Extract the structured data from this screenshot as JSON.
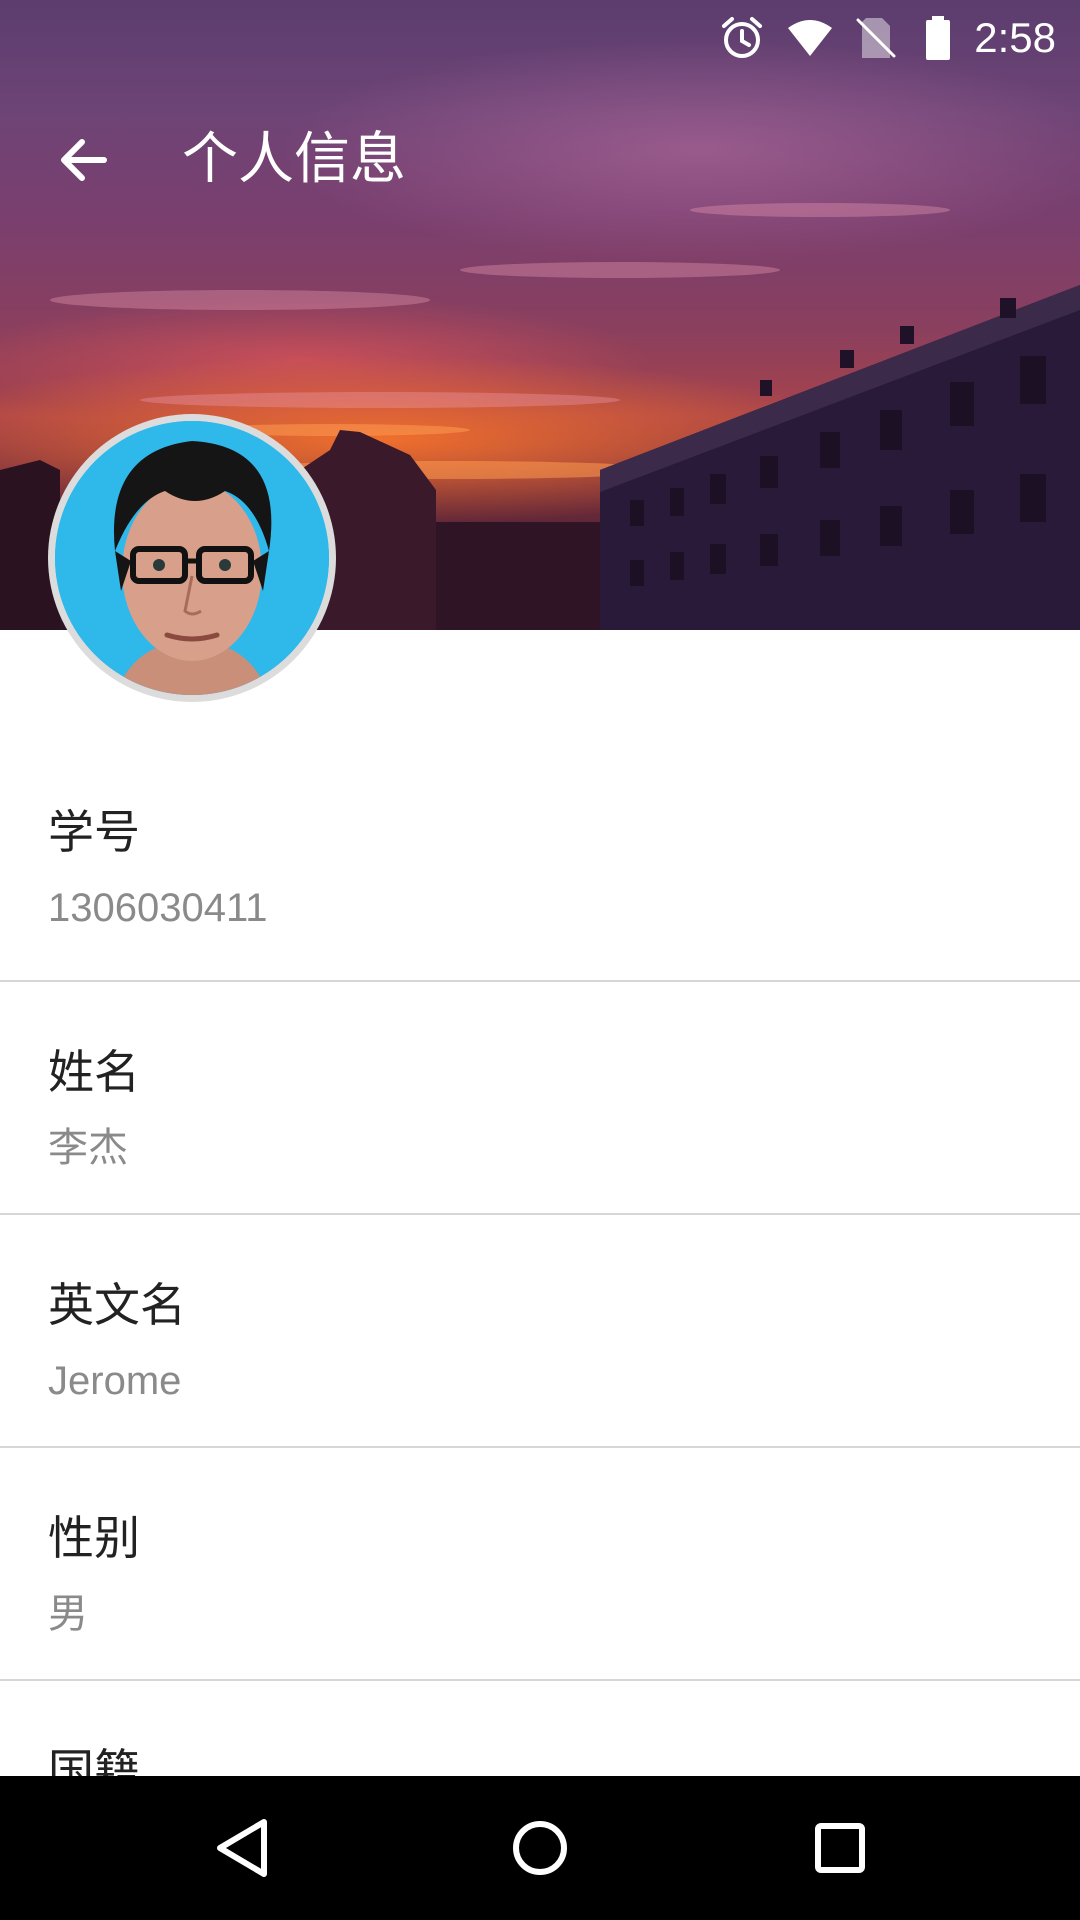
{
  "status_bar": {
    "time": "2:58",
    "icons": [
      "alarm-icon",
      "wifi-icon",
      "no-sim-icon",
      "battery-icon"
    ]
  },
  "toolbar": {
    "back_icon": "arrow-left-icon",
    "title": "个人信息"
  },
  "profile": {
    "avatar_icon": "profile-photo"
  },
  "fields": [
    {
      "label": "学号",
      "value": "1306030411"
    },
    {
      "label": "姓名",
      "value": "李杰"
    },
    {
      "label": "英文名",
      "value": "Jerome"
    },
    {
      "label": "性别",
      "value": "男"
    },
    {
      "label": "国籍",
      "value": ""
    }
  ],
  "nav_bar": {
    "back": "nav-back-icon",
    "home": "nav-home-icon",
    "recents": "nav-recents-icon"
  },
  "colors": {
    "divider": "#d6d6d6",
    "label_text": "#222222",
    "value_text": "#8a8a8a",
    "avatar_bg": "#2fb8ea"
  }
}
